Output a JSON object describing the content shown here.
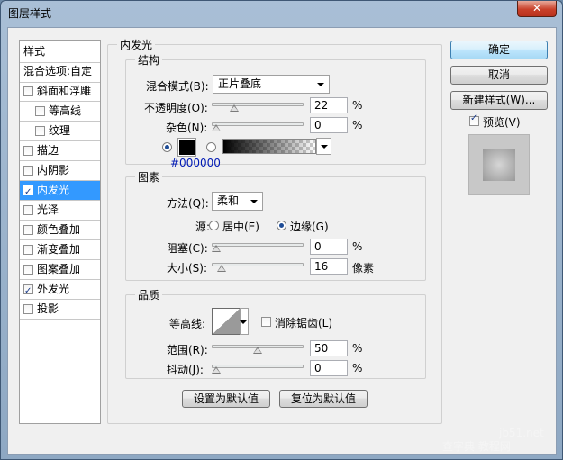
{
  "window": {
    "title": "图层样式",
    "close_glyph": "✕"
  },
  "style_list": {
    "header": "样式",
    "blend_options": "混合选项:自定",
    "items": [
      {
        "label": "斜面和浮雕",
        "checked": false,
        "indent": false,
        "selected": false
      },
      {
        "label": "等高线",
        "checked": false,
        "indent": true,
        "selected": false
      },
      {
        "label": "纹理",
        "checked": false,
        "indent": true,
        "selected": false
      },
      {
        "label": "描边",
        "checked": false,
        "indent": false,
        "selected": false
      },
      {
        "label": "内阴影",
        "checked": false,
        "indent": false,
        "selected": false
      },
      {
        "label": "内发光",
        "checked": true,
        "indent": false,
        "selected": true
      },
      {
        "label": "光泽",
        "checked": false,
        "indent": false,
        "selected": false
      },
      {
        "label": "颜色叠加",
        "checked": false,
        "indent": false,
        "selected": false
      },
      {
        "label": "渐变叠加",
        "checked": false,
        "indent": false,
        "selected": false
      },
      {
        "label": "图案叠加",
        "checked": false,
        "indent": false,
        "selected": false
      },
      {
        "label": "外发光",
        "checked": true,
        "indent": false,
        "selected": false
      },
      {
        "label": "投影",
        "checked": false,
        "indent": false,
        "selected": false
      }
    ]
  },
  "panel": {
    "title": "内发光",
    "structure": {
      "title": "结构",
      "blend_mode_label": "混合模式(B):",
      "blend_mode_value": "正片叠底",
      "opacity_label": "不透明度(O):",
      "opacity_value": "22",
      "opacity_unit": "%",
      "opacity_fraction": 0.22,
      "noise_label": "杂色(N):",
      "noise_value": "0",
      "noise_unit": "%",
      "noise_fraction": 0,
      "color_mode": "solid",
      "color_hex": "#000000"
    },
    "elements": {
      "title": "图素",
      "technique_label": "方法(Q):",
      "technique_value": "柔和",
      "source_label": "源:",
      "source_center": "居中(E)",
      "source_edge": "边缘(G)",
      "source_selected": "edge",
      "choke_label": "阻塞(C):",
      "choke_value": "0",
      "choke_unit": "%",
      "choke_fraction": 0,
      "size_label": "大小(S):",
      "size_value": "16",
      "size_unit": "像素",
      "size_fraction": 0.06
    },
    "quality": {
      "title": "品质",
      "contour_label": "等高线:",
      "antialias_label": "消除锯齿(L)",
      "antialias_checked": false,
      "range_label": "范围(R):",
      "range_value": "50",
      "range_unit": "%",
      "range_fraction": 0.5,
      "jitter_label": "抖动(J):",
      "jitter_value": "0",
      "jitter_unit": "%",
      "jitter_fraction": 0
    },
    "make_default": "设置为默认值",
    "reset_default": "复位为默认值"
  },
  "buttons": {
    "ok": "确定",
    "cancel": "取消",
    "new_style": "新建样式(W)...",
    "preview_label": "预览(V)",
    "preview_checked": true
  },
  "watermark": {
    "line1": "jb51.net",
    "line2": "查字典 教程网"
  }
}
